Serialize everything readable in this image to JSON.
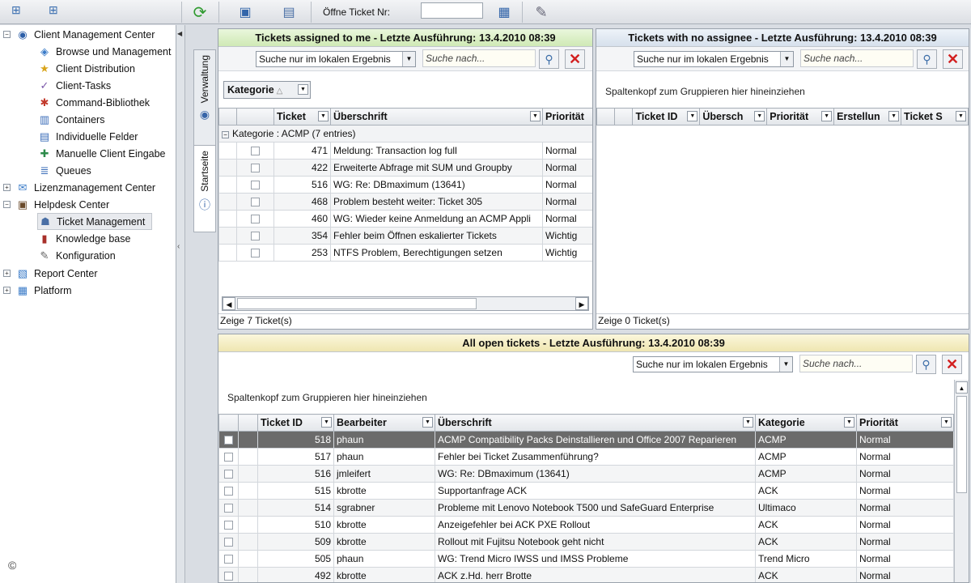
{
  "toolbar": {
    "open_ticket_label": "Öffne Ticket Nr:",
    "open_ticket_value": ""
  },
  "tree": {
    "items": [
      {
        "label": "Client Management Center",
        "toggle": "−",
        "icon": "globe-icon"
      },
      {
        "label": "Browse und Management",
        "icon": "browse-icon"
      },
      {
        "label": "Client Distribution",
        "icon": "star-icon"
      },
      {
        "label": "Client-Tasks",
        "icon": "task-icon"
      },
      {
        "label": "Command-Bibliothek",
        "icon": "command-icon"
      },
      {
        "label": "Containers",
        "icon": "container-icon"
      },
      {
        "label": "Individuelle Felder",
        "icon": "fields-icon"
      },
      {
        "label": "Manuelle Client Eingabe",
        "icon": "manual-input-icon"
      },
      {
        "label": "Queues",
        "icon": "queue-icon"
      },
      {
        "label": "Lizenzmanagement Center",
        "toggle": "+",
        "icon": "license-icon"
      },
      {
        "label": "Helpdesk Center",
        "toggle": "−",
        "icon": "helpdesk-icon"
      },
      {
        "label": "Ticket Management",
        "icon": "ticket-icon"
      },
      {
        "label": "Knowledge base",
        "icon": "book-icon"
      },
      {
        "label": "Konfiguration",
        "icon": "config-icon"
      },
      {
        "label": "Report Center",
        "toggle": "+",
        "icon": "report-icon"
      },
      {
        "label": "Platform",
        "toggle": "+",
        "icon": "platform-icon"
      }
    ]
  },
  "vtabs": {
    "verwaltung": "Verwaltung",
    "startseite": "Startseite"
  },
  "panel_assigned": {
    "title": "Tickets assigned to me - Letzte Ausführung: 13.4.2010 08:39",
    "scope_select": "Suche nur im lokalen Ergebnis",
    "search_placeholder": "Suche nach...",
    "group_button": "Kategorie",
    "columns": [
      "Ticket",
      "Überschrift",
      "Priorität"
    ],
    "group_label": "Kategorie : ACMP (7 entries)",
    "rows": [
      {
        "id": "471",
        "title": "Meldung: Transaction log full",
        "prio": "Normal"
      },
      {
        "id": "422",
        "title": "Erweiterte Abfrage mit SUM und Groupby",
        "prio": "Normal"
      },
      {
        "id": "516",
        "title": "WG: Re: DBmaximum (13641)",
        "prio": "Normal"
      },
      {
        "id": "468",
        "title": "Problem besteht weiter: Ticket 305",
        "prio": "Normal"
      },
      {
        "id": "460",
        "title": "WG: Wieder keine Anmeldung an ACMP Appli",
        "prio": "Normal"
      },
      {
        "id": "354",
        "title": "Fehler beim Öffnen eskalierter Tickets",
        "prio": "Wichtig"
      },
      {
        "id": "253",
        "title": "NTFS Problem, Berechtigungen setzen",
        "prio": "Wichtig"
      }
    ],
    "footer": "Zeige 7 Ticket(s)"
  },
  "panel_noassignee": {
    "title": "Tickets with no assignee - Letzte Ausführung: 13.4.2010 08:39",
    "scope_select": "Suche nur im lokalen Ergebnis",
    "search_placeholder": "Suche nach...",
    "group_hint": "Spaltenkopf zum Gruppieren hier hineinziehen",
    "columns": [
      "Ticket ID",
      "Übersch",
      "Priorität",
      "Erstellun",
      "Ticket S"
    ],
    "footer": "Zeige 0 Ticket(s)"
  },
  "panel_open": {
    "title": "All open tickets - Letzte Ausführung: 13.4.2010 08:39",
    "scope_select": "Suche nur im lokalen Ergebnis",
    "search_placeholder": "Suche nach...",
    "group_hint": "Spaltenkopf zum Gruppieren hier hineinziehen",
    "columns": [
      "Ticket ID",
      "Bearbeiter",
      "Überschrift",
      "Kategorie",
      "Priorität"
    ],
    "rows": [
      {
        "id": "518",
        "user": "phaun",
        "title": "ACMP Compatibility Packs Deinstallieren und Office 2007 Reparieren",
        "cat": "ACMP",
        "prio": "Normal"
      },
      {
        "id": "517",
        "user": "phaun",
        "title": "Fehler bei Ticket Zusammenführung?",
        "cat": "ACMP",
        "prio": "Normal"
      },
      {
        "id": "516",
        "user": "jmleifert",
        "title": "WG: Re: DBmaximum (13641)",
        "cat": "ACMP",
        "prio": "Normal"
      },
      {
        "id": "515",
        "user": "kbrotte",
        "title": "Supportanfrage ACK",
        "cat": "ACK",
        "prio": "Normal"
      },
      {
        "id": "514",
        "user": "sgrabner",
        "title": "Probleme mit Lenovo Notebook T500 und SafeGuard Enterprise",
        "cat": "Ultimaco",
        "prio": "Normal"
      },
      {
        "id": "510",
        "user": "kbrotte",
        "title": "Anzeigefehler bei ACK PXE Rollout",
        "cat": "ACK",
        "prio": "Normal"
      },
      {
        "id": "509",
        "user": "kbrotte",
        "title": "Rollout mit Fujitsu Notebook geht nicht",
        "cat": "ACK",
        "prio": "Normal"
      },
      {
        "id": "505",
        "user": "phaun",
        "title": "WG: Trend Micro IWSS und IMSS Probleme",
        "cat": "Trend Micro",
        "prio": "Normal"
      },
      {
        "id": "492",
        "user": "kbrotte",
        "title": "ACK z.Hd. herr Brotte",
        "cat": "ACK",
        "prio": "Normal"
      }
    ]
  },
  "copyright": "©"
}
